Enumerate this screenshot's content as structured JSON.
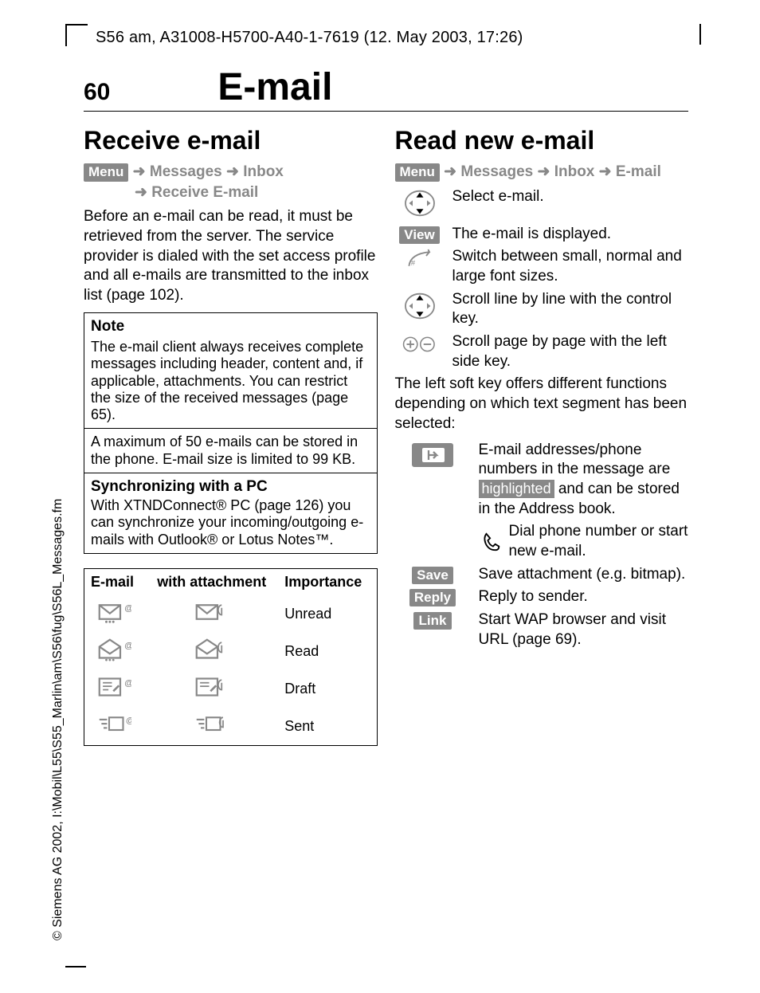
{
  "header_meta": "S56 am, A31008-H5700-A40-1-7619 (12. May 2003, 17:26)",
  "side_copyright": "© Siemens AG 2002, I:\\Mobil\\L55\\S55_Marlin\\am\\S56\\fug\\S56L_Messages.fm",
  "page_number": "60",
  "chapter": "E-mail",
  "left": {
    "title": "Receive e-mail",
    "menu_label": "Menu",
    "crumbs": [
      "Messages",
      "Inbox"
    ],
    "crumbs_line2": "Receive E-mail",
    "para": "Before an e-mail can be read, it must be retrieved from the server. The service provider is dialed with the set access profile and all e-mails are transmitted to the inbox list (page 102).",
    "note": {
      "title": "Note",
      "p1": "The e-mail client always receives complete messages including header, content and, if applicable, attachments. You can restrict the size of the received messages (page 65).",
      "p2": "A maximum of 50 e-mails can be stored in the phone. E-mail size is limited to 99 KB.",
      "sync_title": "Synchronizing with a PC",
      "sync_p": "With XTNDConnect® PC (page 126) you can synchronize your incoming/outgoing e-mails with Outlook® or Lotus Notes™."
    },
    "table": {
      "headers": [
        "E-mail",
        "with attachment",
        "Importance"
      ],
      "rows": [
        {
          "status": "Unread"
        },
        {
          "status": "Read"
        },
        {
          "status": "Draft"
        },
        {
          "status": "Sent"
        }
      ]
    }
  },
  "right": {
    "title": "Read new e-mail",
    "menu_label": "Menu",
    "crumbs": [
      "Messages",
      "Inbox",
      "E-mail"
    ],
    "items": {
      "select": "Select e-mail.",
      "view_label": "View",
      "view_desc": "The e-mail is displayed.",
      "font_desc": "Switch between small, normal and large font sizes.",
      "scroll_line": "Scroll line by line with the control key.",
      "scroll_page": "Scroll page by page with the left side key."
    },
    "para": "The left soft key offers different functions depending on which text segment has been selected:",
    "hl_word": "highlighted",
    "attach_pre": "E-mail addresses/phone numbers in the message are ",
    "attach_post": " and can be stored in the Address book.",
    "dial": "Dial phone number or start new e-mail.",
    "save_label": "Save",
    "save_desc": "Save attachment (e.g. bitmap).",
    "reply_label": "Reply",
    "reply_desc": "Reply to sender.",
    "link_label": "Link",
    "link_desc": "Start WAP browser and visit URL (page 69)."
  }
}
